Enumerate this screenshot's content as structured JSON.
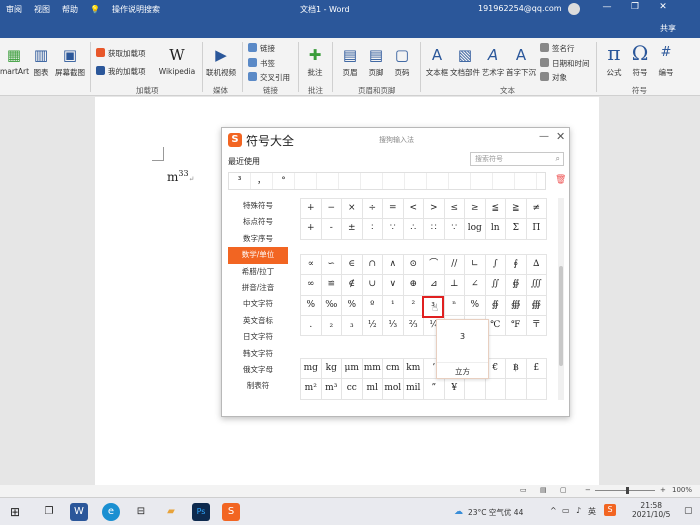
{
  "window": {
    "title": "文档1  -  Word",
    "user_email": "191962254@qq.com",
    "menu": [
      "审阅",
      "视图",
      "帮助"
    ],
    "tell_me": "操作说明搜索",
    "share": "共享",
    "min_glyph": "—",
    "max_glyph": "❐",
    "close_glyph": "✕"
  },
  "ribbon": {
    "smartart": "martArt",
    "chart": "图表",
    "screenshot": "屏幕截图",
    "get_addins": "获取加载项",
    "my_addins": "我的加载项",
    "wikipedia": "Wikipedia",
    "online_video": "联机视频",
    "link": "链接",
    "bookmark": "书签",
    "cross_ref": "交叉引用",
    "comment": "批注",
    "header": "页眉",
    "footer": "页脚",
    "page_number": "页码",
    "textbox": "文本框",
    "doc_parts": "文档部件",
    "wordart": "艺术字",
    "dropcap": "首字下沉",
    "signature_line": "签名行",
    "date_time": "日期和时间",
    "object": "对象",
    "equation": "公式",
    "symbol": "符号",
    "numbering": "编号",
    "groups": {
      "addins": "加载项",
      "media": "媒体",
      "links": "链接",
      "comments": "批注",
      "header_footer": "页眉和页脚",
      "text": "文本",
      "symbols": "符号"
    }
  },
  "document": {
    "text": "m",
    "sup": "33",
    "mark": "↵"
  },
  "dialog": {
    "title": "符号大全",
    "subtitle": "搜狗输入法",
    "minimize": "—",
    "close": "✕",
    "recent_label": "最近使用",
    "search_placeholder": "搜索符号",
    "recent": [
      "³",
      "，",
      "°"
    ],
    "categories": [
      "特殊符号",
      "标点符号",
      "数字序号",
      "数学/单位",
      "希腊/拉丁",
      "拼音/注音",
      "中文字符",
      "英文音标",
      "日文字符",
      "韩文字符",
      "俄文字母",
      "制表符"
    ],
    "active_category": "数学/单位",
    "grid_top": [
      [
        "+",
        "−",
        "×",
        "÷",
        "=",
        "<",
        ">",
        "≤",
        "≥",
        "≦",
        "≧",
        "≠"
      ],
      [
        "+",
        "-",
        "±",
        "∶",
        "∵",
        "∴",
        "∷",
        "∵",
        "log",
        "ln",
        "Σ",
        "Π"
      ]
    ],
    "grid_math": [
      [
        "∝",
        "∽",
        "∈",
        "∩",
        "∧",
        "⊙",
        "⌒",
        "//",
        "∟",
        "∫",
        "∮",
        "∆"
      ],
      [
        "∞",
        "≌",
        "∉",
        "∪",
        "∨",
        "⊕",
        "⊿",
        "⊥",
        "∠",
        "∬",
        "∯",
        "∭"
      ],
      [
        "%",
        "‰",
        "%",
        "º",
        "¹",
        "²",
        "³",
        "ⁿ",
        "%",
        "∯",
        "∰",
        "∰"
      ],
      [
        ".",
        "₂",
        "₃",
        "½",
        "⅓",
        "⅔",
        "¼",
        "",
        "",
        "℃",
        "℉",
        "〒"
      ]
    ],
    "grid_units": [
      [
        "mg",
        "kg",
        "μm",
        "mm",
        "cm",
        "km",
        "’",
        "",
        "",
        "€",
        "฿",
        "£"
      ],
      [
        "m²",
        "m³",
        "cc",
        "ml",
        "mol",
        "mil",
        "”",
        "¥",
        "",
        "",
        "",
        ""
      ]
    ],
    "selected_symbol": "³",
    "popup_char": "3",
    "popup_name": "立方"
  },
  "status": {
    "zoom": "100%"
  },
  "taskbar": {
    "weather": "23°C 空气优 44",
    "lang": "英",
    "time": "21:58",
    "date": "2021/10/5"
  }
}
